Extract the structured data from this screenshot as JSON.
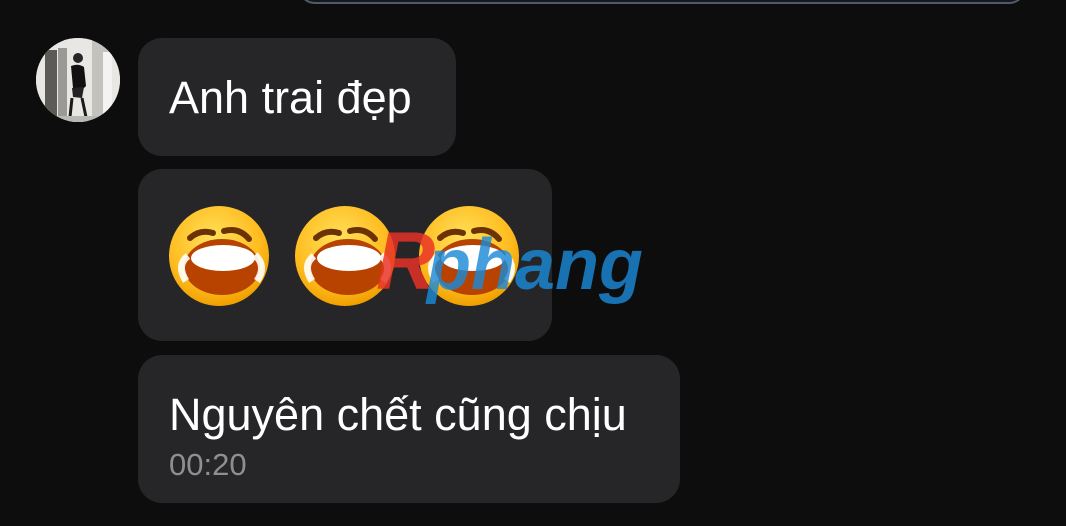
{
  "messages": [
    {
      "text": "Anh trai đẹp"
    },
    {
      "emojis": [
        "laughing-crying-emoji",
        "laughing-crying-emoji",
        "laughing-crying-emoji"
      ]
    },
    {
      "text": "Nguyên chết cũng chịu",
      "time": "00:20"
    }
  ],
  "watermark": {
    "text": "Rphang"
  },
  "colors": {
    "background": "#0d0d0e",
    "bubble": "#262628",
    "time": "#8d8f93",
    "watermark_red": "#ea3127",
    "watermark_blue": "#1b8ad8"
  }
}
